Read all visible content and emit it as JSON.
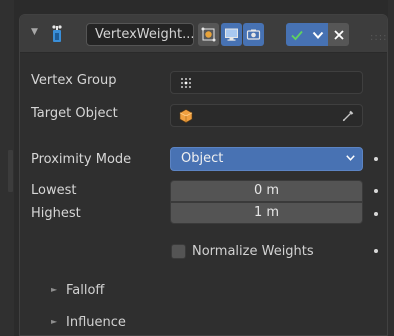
{
  "modifier": {
    "name": "VertexWeight...",
    "icon": "vertex-weight-modifier-icon",
    "header_buttons": {
      "edit_mode_icon": "edit-mode-icon",
      "viewport_icon": "monitor-icon",
      "render_icon": "camera-icon",
      "apply_icon": "checkmark-icon",
      "dropdown_icon": "chevron-down-icon",
      "close_icon": "close-icon"
    }
  },
  "fields": {
    "vertex_group_label": "Vertex Group",
    "vertex_group_value": "",
    "target_object_label": "Target Object",
    "target_object_value": "",
    "proximity_mode_label": "Proximity Mode",
    "proximity_mode_value": "Object",
    "lowest_label": "Lowest",
    "lowest_value": "0 m",
    "highest_label": "Highest",
    "highest_value": "1 m",
    "normalize_label": "Normalize Weights",
    "normalize_checked": false
  },
  "subpanels": {
    "falloff": "Falloff",
    "influence": "Influence"
  },
  "colors": {
    "accent": "#4772b3",
    "panel_bg": "#2f2f2f",
    "header_bg": "#3d3d3d",
    "object_icon": "#f0a040"
  }
}
